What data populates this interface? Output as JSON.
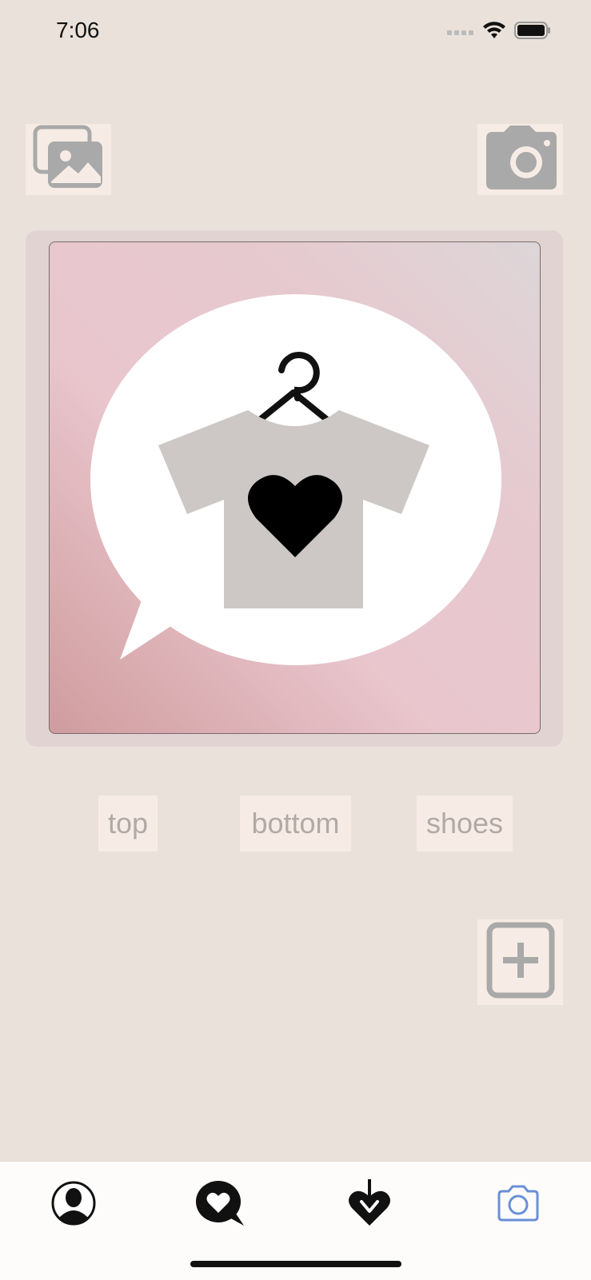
{
  "status_bar": {
    "time": "7:06"
  },
  "toolbar": {
    "gallery_icon": "photo-gallery-icon",
    "camera_icon": "camera-icon"
  },
  "preview": {
    "image": "speech-bubble-tshirt-heart-logo"
  },
  "categories": [
    {
      "label": "top"
    },
    {
      "label": "bottom"
    },
    {
      "label": "shoes"
    }
  ],
  "add": {
    "icon": "plus-square-icon"
  },
  "tabbar": {
    "tabs": [
      {
        "icon": "profile-icon"
      },
      {
        "icon": "heart-chat-icon"
      },
      {
        "icon": "heart-download-icon"
      },
      {
        "icon": "camera-icon",
        "selected": true
      }
    ],
    "accent": "#6a8fd8"
  },
  "colors": {
    "background": "#eae2da",
    "button_bg": "#f6ece5",
    "icon_gray": "#a9a9a9"
  }
}
